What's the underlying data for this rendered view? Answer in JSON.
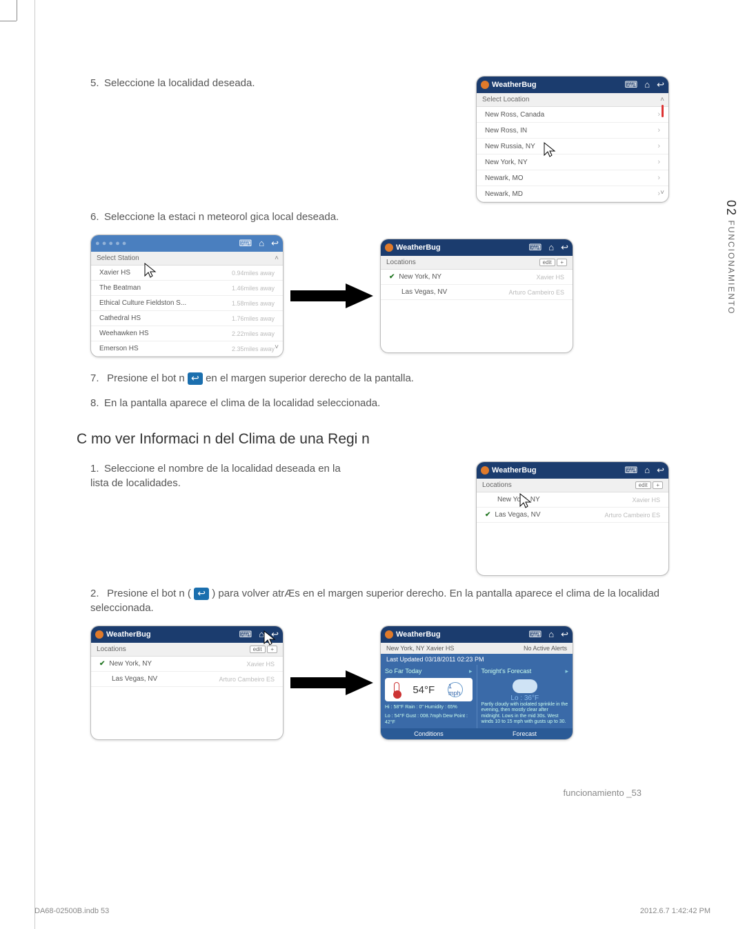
{
  "sideTab": {
    "num": "02",
    "label": "FUNCIONAMIENTO"
  },
  "footerRight": "funcionamiento _53",
  "printLeft": "DA68-02500B.indb   53",
  "printRight": "2012.6.7   1:42:42 PM",
  "brand": "WeatherBug",
  "editBtn": "edit",
  "plusBtn": "+",
  "step5": {
    "num": "5.",
    "text": "Seleccione la localidad deseada."
  },
  "step6": {
    "num": "6.",
    "text": "Seleccione la estaci n meteorol gica local deseada."
  },
  "step7": {
    "num": "7.",
    "pre": "Presione el bot n",
    "post": "en el margen superior derecho de la pantalla."
  },
  "step8": {
    "num": "8.",
    "text": "En la pantalla aparece el clima de la localidad seleccionada."
  },
  "subhead": "C mo ver Informaci n del Clima de una Regi n",
  "r_step1": {
    "num": "1.",
    "text": "Seleccione el nombre de la localidad deseada en la lista de localidades."
  },
  "r_step2": {
    "num": "2.",
    "text": "Presione el bot n (",
    "post": ") para volver atrÆs en el margen superior derecho. En la pantalla aparece el clima de la localidad seleccionada."
  },
  "selectLocation": {
    "header": "Select Location",
    "items": [
      "New Ross, Canada",
      "New Ross, IN",
      "New Russia, NY",
      "New York, NY",
      "Newark, MO",
      "Newark, MD"
    ]
  },
  "selectStation": {
    "header": "Select Station",
    "items": [
      {
        "name": "Xavier HS",
        "dist": "0.94miles away"
      },
      {
        "name": "The Beatman",
        "dist": "1.46miles away"
      },
      {
        "name": "Ethical Culture Fieldston S...",
        "dist": "1.58miles away"
      },
      {
        "name": "Cathedral HS",
        "dist": "1.76miles away"
      },
      {
        "name": "Weehawken HS",
        "dist": "2.22miles away"
      },
      {
        "name": "Emerson HS",
        "dist": "2.35miles away"
      }
    ]
  },
  "locationsA": {
    "header": "Locations",
    "rows": [
      {
        "city": "New York, NY",
        "station": "Xavier HS",
        "checked": true
      },
      {
        "city": "Las Vegas, NV",
        "station": "Arturo Cambeiro ES",
        "checked": false
      }
    ]
  },
  "locationsB": {
    "header": "Locations",
    "rows": [
      {
        "city": "New York, NY",
        "station": "Xavier HS",
        "checked": false
      },
      {
        "city": "Las Vegas, NV",
        "station": "Arturo Cambeiro ES",
        "checked": true
      }
    ]
  },
  "detail": {
    "loc": "New York, NY Xavier HS",
    "alerts": "No Active Alerts",
    "updated": "Last Updated 03/18/2011 02:23 PM",
    "leftLabel": "So Far Today",
    "temp": "54°F",
    "wind": "1 mph",
    "stats1": "Hi : 58°F    Rain : 0\"        Humidity : 65%",
    "stats2": "Lo : 54°F   Gust : 008.7mph   Dew Point : 42°F",
    "rightLabel": "Tonight's Forecast",
    "lo": "Lo : 36°F",
    "forecast": "Partly cloudy with isolated sprinkle in the evening, then mostly clear after midnight. Lows in the mid 30s. West winds 10 to 15 mph with gusts up to 30.",
    "tabCond": "Conditions",
    "tabFore": "Forecast"
  }
}
